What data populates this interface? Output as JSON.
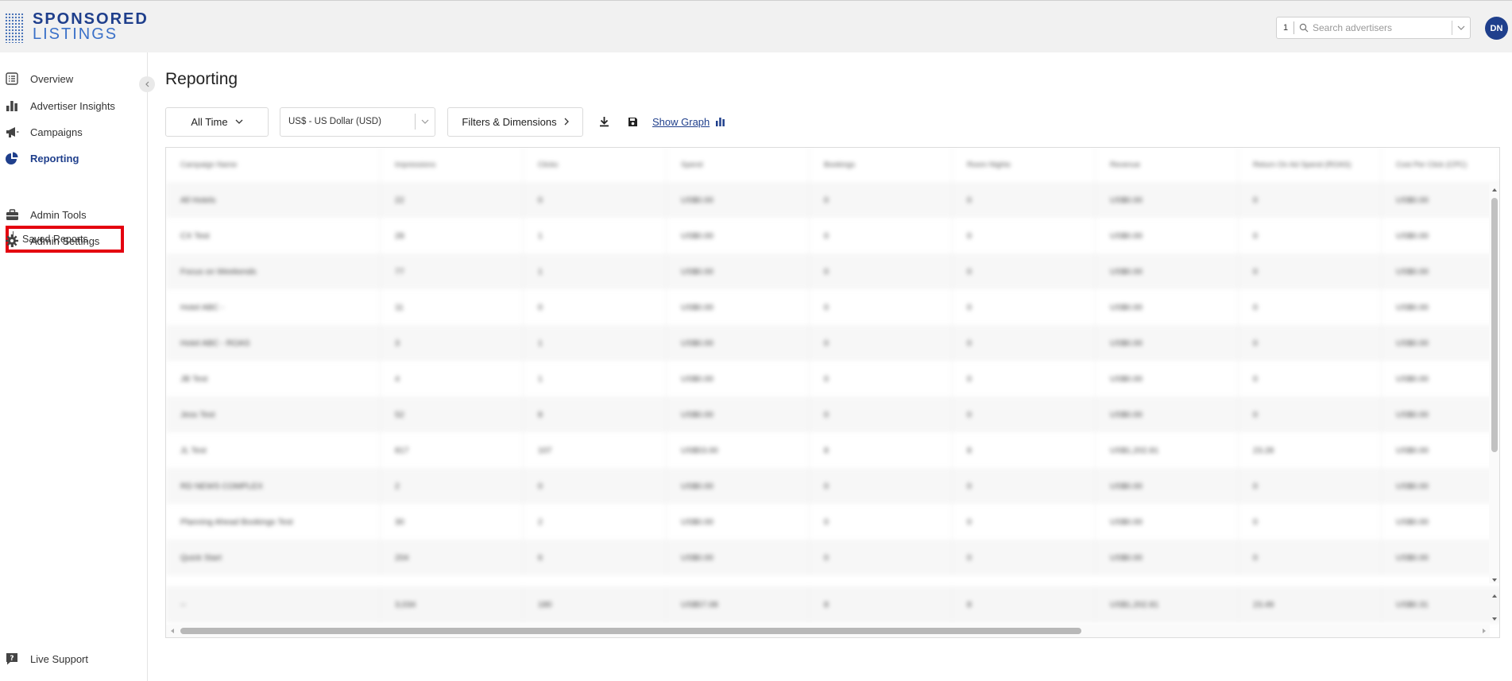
{
  "brand": {
    "line1": "SPONSORED",
    "line2": "LISTINGS"
  },
  "header": {
    "advertiser_count": "1",
    "search_placeholder": "Search advertisers",
    "avatar_initials": "DN"
  },
  "sidebar": {
    "items": [
      {
        "label": "Overview",
        "icon": "list-icon"
      },
      {
        "label": "Advertiser Insights",
        "icon": "bar-chart-icon"
      },
      {
        "label": "Campaigns",
        "icon": "megaphone-icon"
      },
      {
        "label": "Reporting",
        "icon": "pie-chart-icon",
        "active": true
      },
      {
        "label": "Admin Tools",
        "icon": "toolbox-icon"
      },
      {
        "label": "Admin Settings",
        "icon": "gear-icon"
      }
    ],
    "saved_reports_label": "Saved Reports",
    "live_support_label": "Live Support"
  },
  "main": {
    "title": "Reporting",
    "toolbar": {
      "date_range": "All Time",
      "currency": "US$ - US Dollar (USD)",
      "filters": "Filters & Dimensions",
      "show_graph": "Show Graph"
    }
  },
  "table": {
    "headers": [
      "Campaign Name",
      "Impressions",
      "Clicks",
      "Spend",
      "Bookings",
      "Room Nights",
      "Revenue",
      "Return On Ad Spend (ROAS)",
      "Cost Per Click (CPC)"
    ],
    "rows": [
      [
        "All Hotels",
        "22",
        "0",
        "US$0.00",
        "0",
        "0",
        "US$0.00",
        "0",
        "US$0.00"
      ],
      [
        "CX Test",
        "28",
        "1",
        "US$0.00",
        "0",
        "0",
        "US$0.00",
        "0",
        "US$0.00"
      ],
      [
        "Focus on Weekends",
        "77",
        "1",
        "US$0.00",
        "0",
        "0",
        "US$0.00",
        "0",
        "US$0.00"
      ],
      [
        "Hotel ABC -",
        "11",
        "0",
        "US$0.00",
        "0",
        "0",
        "US$0.00",
        "0",
        "US$0.00"
      ],
      [
        "Hotel ABC - ROAS",
        "3",
        "1",
        "US$0.00",
        "0",
        "0",
        "US$0.00",
        "0",
        "US$0.00"
      ],
      [
        "JB Test",
        "4",
        "1",
        "US$0.00",
        "0",
        "0",
        "US$0.00",
        "0",
        "US$0.00"
      ],
      [
        "Jess Test",
        "52",
        "8",
        "US$0.00",
        "0",
        "0",
        "US$0.00",
        "0",
        "US$0.00"
      ],
      [
        "JL Test",
        "817",
        "107",
        "US$53.00",
        "8",
        "8",
        "US$1,202.81",
        "23.28",
        "US$0.00"
      ],
      [
        "RD NEWS COMPLEX",
        "2",
        "0",
        "US$0.00",
        "0",
        "0",
        "US$0.00",
        "0",
        "US$0.00"
      ],
      [
        "Planning Ahead Bookings Test",
        "30",
        "2",
        "US$0.00",
        "0",
        "0",
        "US$0.00",
        "0",
        "US$0.00"
      ],
      [
        "Quick Start",
        "204",
        "6",
        "US$0.00",
        "0",
        "0",
        "US$0.00",
        "0",
        "US$0.00"
      ]
    ],
    "total": [
      "--",
      "3,034",
      "180",
      "US$57.08",
      "8",
      "8",
      "US$1,202.81",
      "23.49",
      "US$0.31"
    ]
  },
  "colors": {
    "brand": "#1f3f8c",
    "accent": "#3a70c8",
    "highlight": "#e4000f"
  }
}
